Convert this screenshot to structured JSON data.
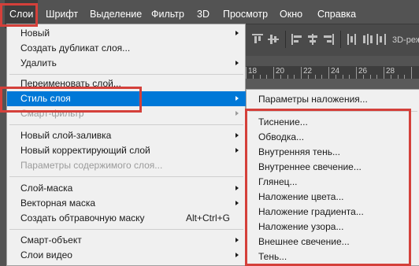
{
  "menubar": {
    "items": [
      "Слои",
      "Шрифт",
      "Выделение",
      "Фильтр",
      "3D",
      "Просмотр",
      "Окно",
      "Справка"
    ]
  },
  "optionsbar": {
    "mode_3d": "3D-реж"
  },
  "ruler": {
    "labels": [
      "18",
      "20",
      "22",
      "24",
      "26",
      "28"
    ]
  },
  "layer_menu": {
    "items": {
      "new": "Новый",
      "duplicate": "Создать дубликат слоя...",
      "delete": "Удалить",
      "rename": "Переименовать слой...",
      "layer_style": "Стиль слоя",
      "smart_filter": "Смарт-фильтр",
      "new_fill_layer": "Новый слой-заливка",
      "new_adjustment_layer": "Новый корректирующий слой",
      "layer_content_options": "Параметры содержимого слоя...",
      "layer_mask": "Слой-маска",
      "vector_mask": "Векторная маска",
      "clipping_mask": "Создать обтравочную маску",
      "clipping_mask_shortcut": "Alt+Ctrl+G",
      "smart_object": "Смарт-объект",
      "video_layers": "Слои видео"
    }
  },
  "style_submenu": {
    "blending_options": "Параметры наложения...",
    "effects": [
      "Тиснение...",
      "Обводка...",
      "Внутренняя тень...",
      "Внутреннее свечение...",
      "Глянец...",
      "Наложение цвета...",
      "Наложение градиента...",
      "Наложение узора...",
      "Внешнее свечение...",
      "Тень..."
    ]
  },
  "colors": {
    "highlight": "#0078d7",
    "annotation_red": "#d4403a",
    "menubar_bg": "#535353",
    "menu_bg": "#f0f0f0"
  }
}
